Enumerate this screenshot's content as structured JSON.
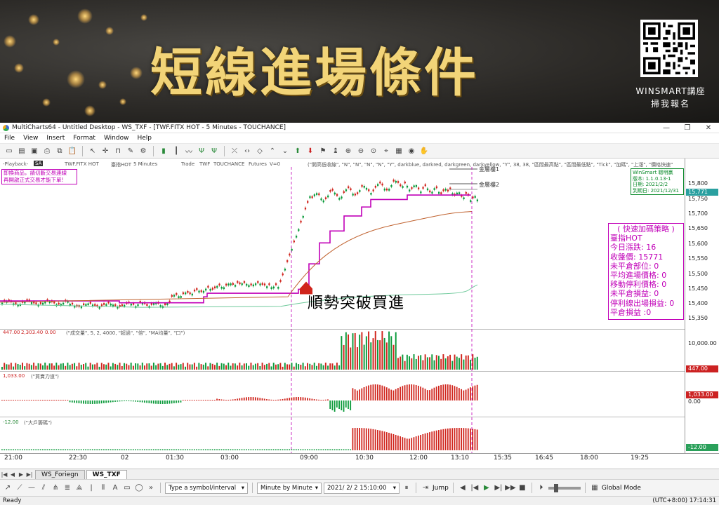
{
  "banner": {
    "title": "短線進場條件",
    "brand": "WINSMART講座",
    "signup": "掃我報名"
  },
  "window": {
    "title": "MultiCharts64 - Untitled Desktop - WS_TXF - [TWF.FITX HOT - 5 Minutes - TOUCHANCE]",
    "controls": [
      "—",
      "❐",
      "✕"
    ]
  },
  "menu": [
    "File",
    "View",
    "Insert",
    "Format",
    "Window",
    "Help"
  ],
  "chart_header": {
    "playback": "-Playback-",
    "sa": "SA",
    "symbol_line": "TWF.FITX HOT",
    "desc": "臺指HOT",
    "interval": "5 Minutes",
    "session": "Trade",
    "feed": "TWF",
    "source": "TOUCHANCE",
    "category": "Futures",
    "volume_label": "V=0",
    "indicator": "(\"開高低收線\", \"N\", \"N\", \"N\", \"N\", \"Y\", darkblue, darkred, darkgreen, darkyellow, \"Y\", 38, 38, \"區間最高點\", \"區間最低點\", \"Tick\", \"加碼\", \"上漲\", \"價格快速\""
  },
  "warning_box": "即換商品，請切斷交易連線\n再開啟正式交易才能下單!",
  "winsmart_box": [
    "WinSmart 聰明贏",
    "版本: 1.1.0.13-1",
    "日期: 2021/2/2",
    "到期日: 2021/12/31"
  ],
  "strategy_box": {
    "title": "( 快速加碼策略 )",
    "lines": [
      "臺指HOT",
      "今日漲跌: 16",
      "收盤價: 15771",
      "未平倉部位: 0",
      "平均進場價格: 0",
      "移動停利價格: 0",
      "未平倉損益: 0",
      "停利線出場損益: 0",
      "平倉損益 :0"
    ]
  },
  "gold_labels": [
    "金層樓1",
    "金層樓2"
  ],
  "overlay_text": "順勢突破買進",
  "price_axis": {
    "labels": [
      "15,800",
      "15,750",
      "15,700",
      "15,650",
      "15,600",
      "15,550",
      "15,500",
      "15,450",
      "15,400",
      "15,350"
    ],
    "current": "15,771"
  },
  "volume_pane": {
    "header_values": [
      "447.00",
      "2,303.40",
      "0.00"
    ],
    "header_text": "(\"成交量\", 5, 2, 4000, \"超過\", \"倍\", \"MA均量\", \"口\")",
    "axis_label": "10,000.00",
    "tag": "447.00"
  },
  "force_pane": {
    "header_value": "1,033.00",
    "header_text": "(\"買賣力道\")",
    "axis_label": "0.00",
    "tag": "1,033.00"
  },
  "big_pane": {
    "header_value": "-12.00",
    "header_text": "(\"大戶籌碼\")",
    "tag": "-12.00"
  },
  "time_axis": [
    "21:00",
    "22:30",
    "02",
    "01:30",
    "03:00",
    "09:00",
    "10:30",
    "12:00",
    "13:10",
    "15:35",
    "16:45",
    "18:00",
    "19:25"
  ],
  "tabs": [
    "WS_Foriegn",
    "WS_TXF"
  ],
  "drawbar": {
    "symbol_placeholder": "Type a symbol/interval",
    "mode": "Minute by Minute",
    "datetime": "2021/  2/  2 15:10:00",
    "jump": "Jump",
    "global_mode": "Global Mode"
  },
  "status": {
    "left": "Ready",
    "right": "(UTC+8:00) 17:14:31"
  },
  "colors": {
    "gold": "#f2d478",
    "magenta": "#c100b8",
    "up": "#d0241c",
    "down": "#0a9a3a",
    "ma": "#c0622f",
    "green_line": "#6dc99a"
  }
}
